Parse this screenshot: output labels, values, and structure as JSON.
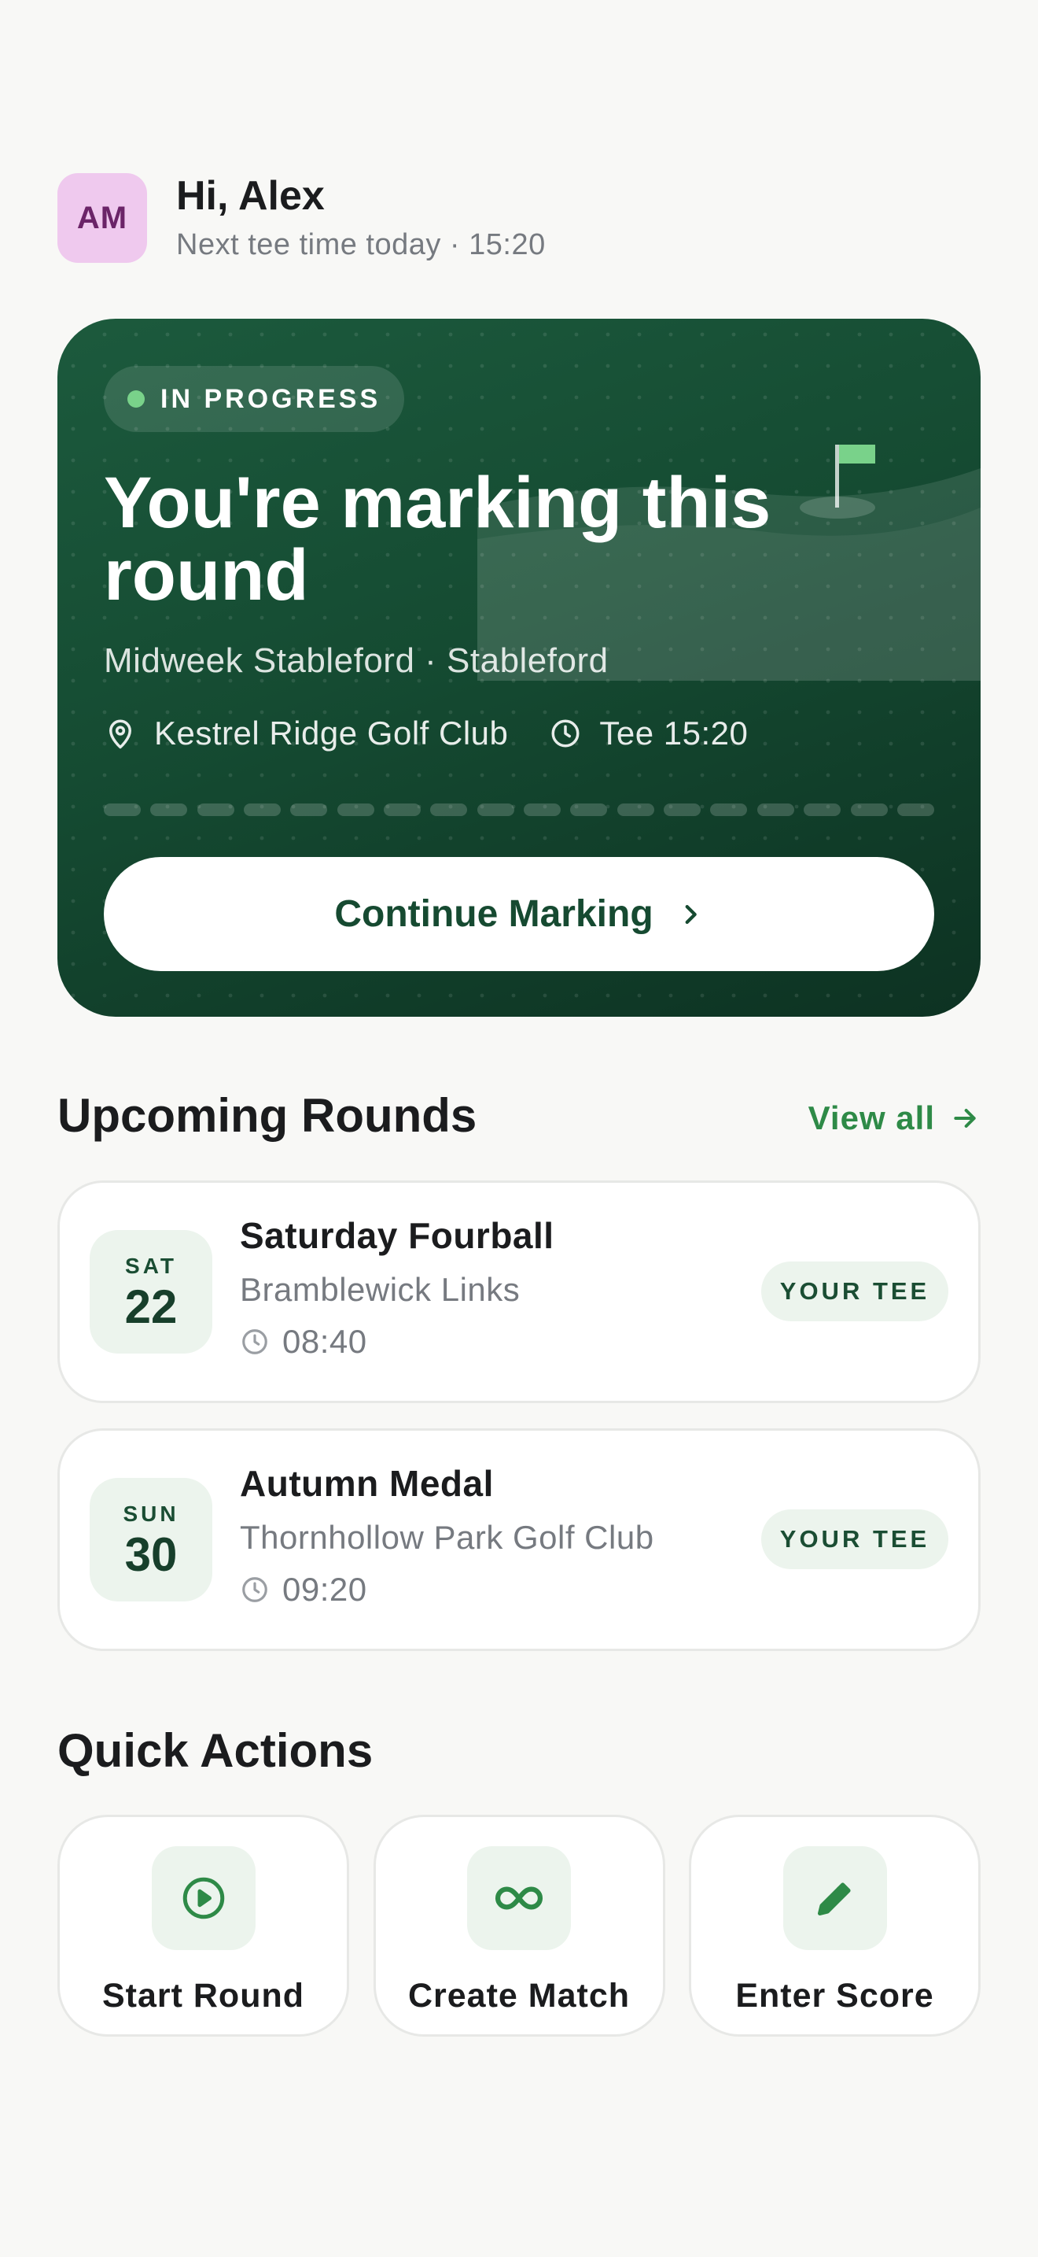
{
  "user": {
    "initials": "AM",
    "greeting": "Hi, Alex",
    "subtitle": "Next tee time today · 15:20"
  },
  "hero": {
    "status": "IN PROGRESS",
    "title": "You're marking this round",
    "subtitle": "Midweek Stableford · Stableford",
    "location": "Kestrel Ridge Golf Club",
    "tee": "Tee 15:20",
    "button_label": "Continue Marking",
    "icons": [
      "map-pin-icon",
      "clock-icon",
      "flag-icon",
      "chevron-right-icon"
    ]
  },
  "upcoming": {
    "title": "Upcoming Rounds",
    "view_all": "View all",
    "rounds": [
      {
        "dow": "SAT",
        "day": "22",
        "name": "Saturday Fourball",
        "course": "Bramblewick Links",
        "time": "08:40",
        "tag": "YOUR TEE"
      },
      {
        "dow": "SUN",
        "day": "30",
        "name": "Autumn Medal",
        "course": "Thornhollow Park Golf Club",
        "time": "09:20",
        "tag": "YOUR TEE"
      }
    ]
  },
  "quick_actions": {
    "title": "Quick Actions",
    "items": [
      {
        "label": "Start Round",
        "icon": "play-circle-icon"
      },
      {
        "label": "Create Match",
        "icon": "infinity-icon"
      },
      {
        "label": "Enter Score",
        "icon": "pencil-icon"
      }
    ]
  },
  "colors": {
    "accent": "#2e8a47",
    "hero_dark": "#154b32",
    "avatar_bg": "#efc9ee",
    "avatar_fg": "#6b2468",
    "status_dot": "#79d28a",
    "flag": "#79d28a"
  }
}
